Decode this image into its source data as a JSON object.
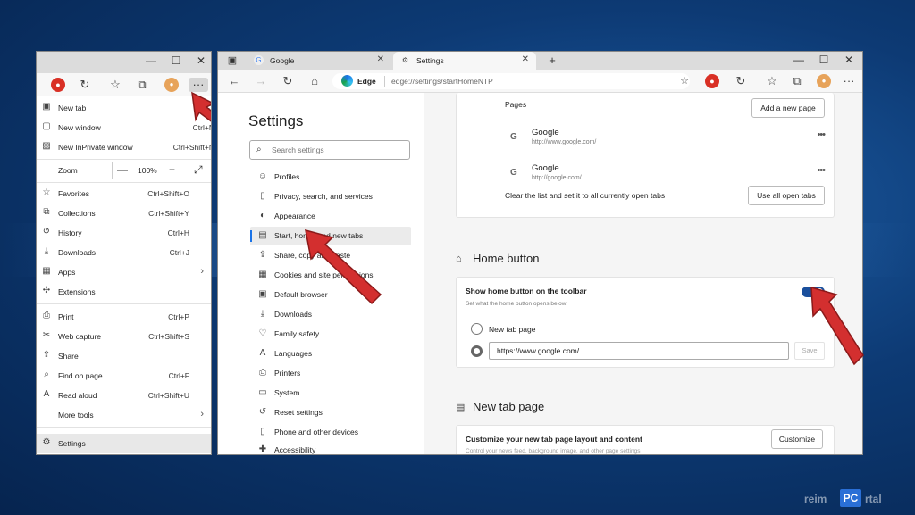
{
  "colors": {
    "accent": "#1a73e8",
    "arrow": "#d32f2f",
    "toggle_on": "#1a4f9c",
    "desktop": "#0d3a74"
  },
  "left_window": {
    "title_buttons": [
      "—",
      "☐",
      "✕"
    ],
    "toolbar_icons": [
      "extension-icon",
      "refresh-icon",
      "favorites-icon",
      "collections-icon",
      "profile-avatar",
      "more-icon"
    ],
    "menu": {
      "items": [
        {
          "name": "new-tab",
          "icon": "new-tab-icon",
          "glyph": "▣",
          "label": "New tab",
          "shortcut": "Ctrl+T"
        },
        {
          "name": "new-window",
          "icon": "new-window-icon",
          "glyph": "▢",
          "label": "New window",
          "shortcut": "Ctrl+N"
        },
        {
          "name": "new-inprivate-window",
          "icon": "inprivate-icon",
          "glyph": "▨",
          "label": "New InPrivate window",
          "shortcut": "Ctrl+Shift+N"
        },
        {
          "name": "favorites",
          "icon": "star-icon",
          "glyph": "☆",
          "label": "Favorites",
          "shortcut": "Ctrl+Shift+O"
        },
        {
          "name": "collections",
          "icon": "collections-icon",
          "glyph": "⧉",
          "label": "Collections",
          "shortcut": "Ctrl+Shift+Y"
        },
        {
          "name": "history",
          "icon": "history-icon",
          "glyph": "↺",
          "label": "History",
          "shortcut": "Ctrl+H"
        },
        {
          "name": "downloads",
          "icon": "download-icon",
          "glyph": "⤓",
          "label": "Downloads",
          "shortcut": "Ctrl+J"
        },
        {
          "name": "apps",
          "icon": "apps-icon",
          "glyph": "▦",
          "label": "Apps",
          "shortcut": ""
        },
        {
          "name": "extensions",
          "icon": "puzzle-icon",
          "glyph": "✣",
          "label": "Extensions",
          "shortcut": ""
        },
        {
          "name": "print",
          "icon": "printer-icon",
          "glyph": "⎙",
          "label": "Print",
          "shortcut": "Ctrl+P"
        },
        {
          "name": "web-capture",
          "icon": "capture-icon",
          "glyph": "✂",
          "label": "Web capture",
          "shortcut": "Ctrl+Shift+S"
        },
        {
          "name": "share",
          "icon": "share-icon",
          "glyph": "⇪",
          "label": "Share",
          "shortcut": ""
        },
        {
          "name": "find-on-page",
          "icon": "find-icon",
          "glyph": "⌕",
          "label": "Find on page",
          "shortcut": "Ctrl+F"
        },
        {
          "name": "read-aloud",
          "icon": "read-aloud-icon",
          "glyph": "A",
          "label": "Read aloud",
          "shortcut": "Ctrl+Shift+U"
        },
        {
          "name": "more-tools",
          "icon": "",
          "glyph": "",
          "label": "More tools",
          "shortcut": ""
        },
        {
          "name": "settings",
          "icon": "gear-icon",
          "glyph": "⚙",
          "label": "Settings",
          "shortcut": ""
        }
      ],
      "zoom": {
        "label": "Zoom",
        "minus": "—",
        "value": "100%",
        "plus": "+",
        "fullscreen": "⤢"
      }
    }
  },
  "right_window": {
    "tabs": [
      {
        "label": "Google",
        "active": false
      },
      {
        "label": "Settings",
        "active": true
      }
    ],
    "new_tab_glyph": "+",
    "title_buttons": [
      "—",
      "☐",
      "✕"
    ],
    "omnibox": {
      "brand": "Edge",
      "url": "edge://settings/startHomeNTP"
    },
    "sidebar": {
      "title": "Settings",
      "search_placeholder": "Search settings",
      "items": [
        {
          "label": "Profiles",
          "icon": "profile-icon",
          "glyph": "☺"
        },
        {
          "label": "Privacy, search, and services",
          "icon": "lock-icon",
          "glyph": "🔒"
        },
        {
          "label": "Appearance",
          "icon": "appearance-icon",
          "glyph": "◐"
        },
        {
          "label": "Start, home, and new tabs",
          "icon": "home-tabs-icon",
          "glyph": "▤",
          "active": true
        },
        {
          "label": "Share, copy and paste",
          "icon": "share-icon",
          "glyph": "⇪"
        },
        {
          "label": "Cookies and site permissions",
          "icon": "cookie-icon",
          "glyph": "▦"
        },
        {
          "label": "Default browser",
          "icon": "browser-icon",
          "glyph": "▣"
        },
        {
          "label": "Downloads",
          "icon": "download-icon",
          "glyph": "⤓"
        },
        {
          "label": "Family safety",
          "icon": "family-icon",
          "glyph": "♡"
        },
        {
          "label": "Languages",
          "icon": "languages-icon",
          "glyph": "A"
        },
        {
          "label": "Printers",
          "icon": "printer-icon",
          "glyph": "⎙"
        },
        {
          "label": "System",
          "icon": "system-icon",
          "glyph": "▭"
        },
        {
          "label": "Reset settings",
          "icon": "reset-icon",
          "glyph": "↺"
        },
        {
          "label": "Phone and other devices",
          "icon": "phone-icon",
          "glyph": "▯"
        },
        {
          "label": "Accessibility",
          "icon": "accessibility-icon",
          "glyph": "♿"
        }
      ]
    },
    "main": {
      "pages_label": "Pages",
      "add_page_button": "Add a new page",
      "pages": [
        {
          "title": "Google",
          "url": "http://www.google.com/"
        },
        {
          "title": "Google",
          "url": "http://google.com/"
        }
      ],
      "clear_text": "Clear the list and set it to all currently open tabs",
      "use_open_tabs_button": "Use all open tabs",
      "home_button": {
        "section_title": "Home button",
        "toggle_label": "Show home button on the toolbar",
        "toggle_sub": "Set what the home button opens below:",
        "toggle_on": true,
        "option_new_tab": "New tab page",
        "url_value": "https://www.google.com/",
        "save_button": "Save"
      },
      "new_tab_page": {
        "section_title": "New tab page",
        "customize_label": "Customize your new tab page layout and content",
        "customize_sub": "Control your news feed, background image, and other page settings",
        "customize_button": "Customize"
      }
    }
  },
  "watermark": {
    "left": "reim",
    "pc": "PC",
    "right": "rtal"
  }
}
